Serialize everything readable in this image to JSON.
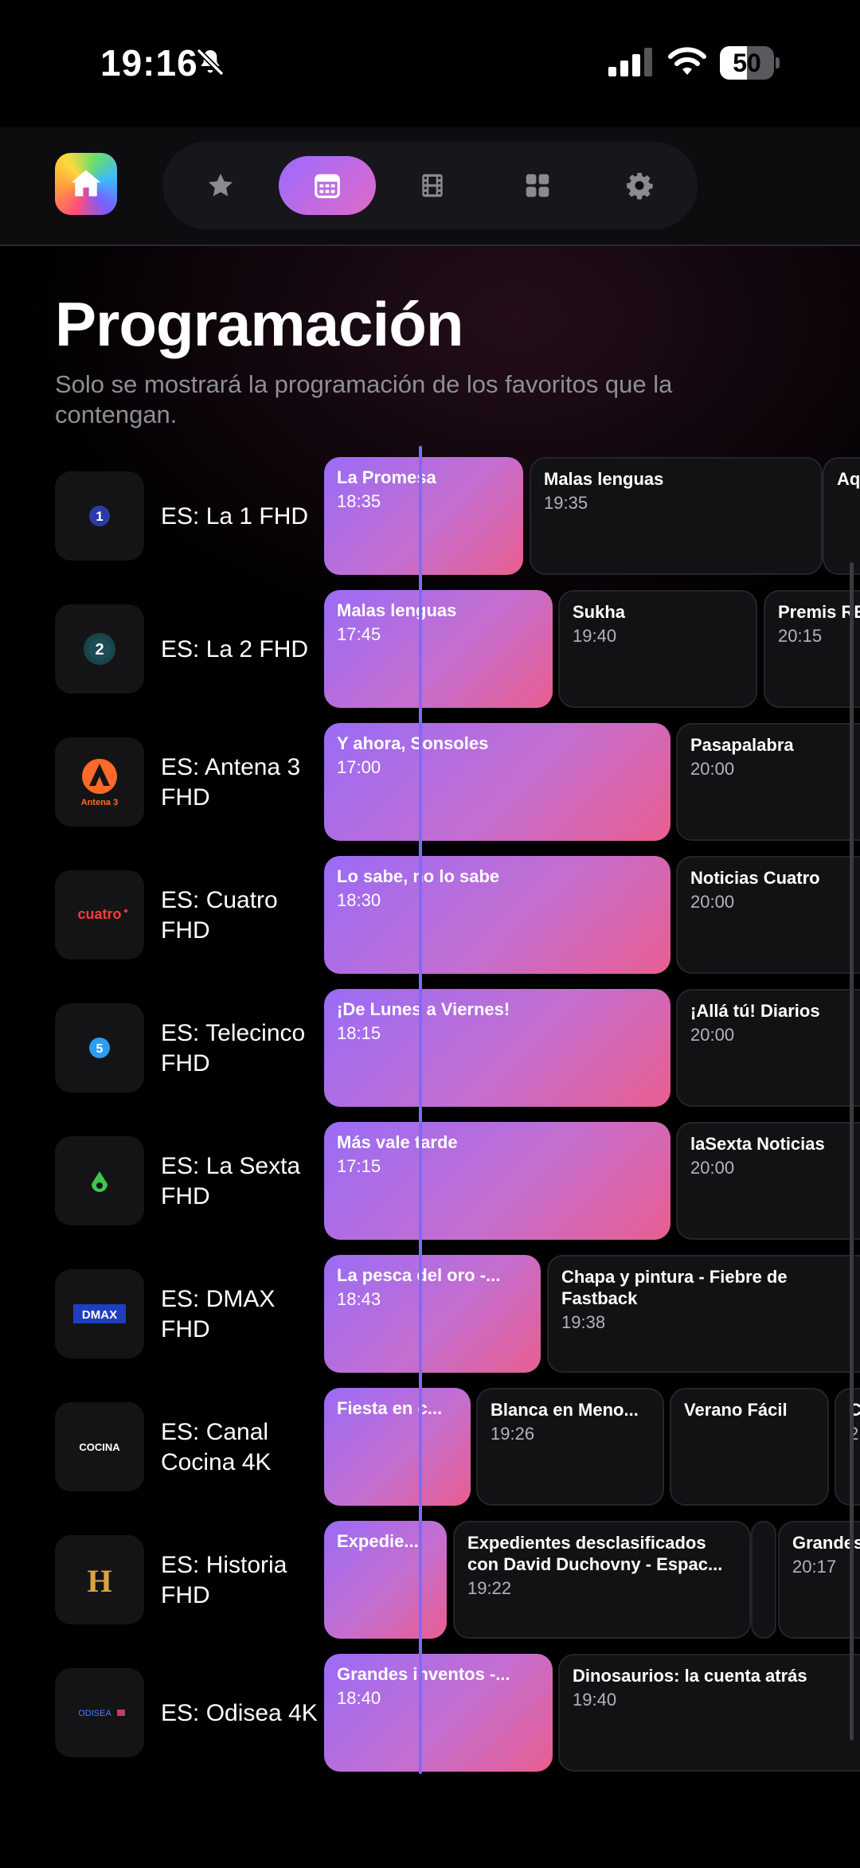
{
  "status_bar": {
    "time": "19:16",
    "battery": "50",
    "battery_level": 0.5
  },
  "nav": {
    "items": [
      "star-icon",
      "calendar-icon",
      "film-icon",
      "grid-icon",
      "gear-icon"
    ],
    "active": "calendar-icon"
  },
  "page": {
    "title": "Programación",
    "subtitle": "Solo se mostrará la programación de los favoritos que la contengan."
  },
  "colors": {
    "accent_start": "#9b6bff",
    "accent_end": "#e95e8f",
    "now_line": "#7b6bff"
  },
  "channels": [
    {
      "name": "ES: La 1 FHD",
      "programs": [
        {
          "title": "La Promesa",
          "time": "18:35"
        },
        {
          "title": "Malas lenguas",
          "time": "19:35"
        },
        {
          "title": "Aq",
          "time": ""
        }
      ]
    },
    {
      "name": "ES: La 2 FHD",
      "programs": [
        {
          "title": "Malas lenguas",
          "time": "17:45"
        },
        {
          "title": "Sukha",
          "time": "19:40"
        },
        {
          "title": "Premis RE",
          "time": "20:15"
        }
      ]
    },
    {
      "name": "ES: Antena 3 FHD",
      "logo_text": "Antena 3",
      "programs": [
        {
          "title": "Y ahora, Sonsoles",
          "time": "17:00"
        },
        {
          "title": "Pasapalabra",
          "time": "20:00"
        }
      ]
    },
    {
      "name": "ES: Cuatro FHD",
      "logo_text": "cuatro",
      "programs": [
        {
          "title": "Lo sabe, no lo sabe",
          "time": "18:30"
        },
        {
          "title": "Noticias Cuatro",
          "time": "20:00"
        }
      ]
    },
    {
      "name": "ES: Telecinco FHD",
      "programs": [
        {
          "title": "¡De Lunes a Viernes!",
          "time": "18:15"
        },
        {
          "title": "¡Allá tú! Diarios",
          "time": "20:00"
        }
      ]
    },
    {
      "name": "ES: La Sexta FHD",
      "programs": [
        {
          "title": "Más vale tarde",
          "time": "17:15"
        },
        {
          "title": "laSexta Noticias",
          "time": "20:00"
        }
      ]
    },
    {
      "name": "ES: DMAX FHD",
      "logo_text": "DMAX",
      "programs": [
        {
          "title": "La pesca del oro -...",
          "time": "18:43"
        },
        {
          "title": "Chapa y pintura - Fiebre de Fastback",
          "time": "19:38"
        }
      ]
    },
    {
      "name": "ES: Canal Cocina 4K",
      "logo_text": "COCINA",
      "programs": [
        {
          "title": "Fiesta en c...",
          "time": ""
        },
        {
          "title": "Blanca en Meno...",
          "time": "19:26"
        },
        {
          "title": "Verano Fácil",
          "time": ""
        },
        {
          "title": "C",
          "time": "2"
        }
      ]
    },
    {
      "name": "ES: Historia FHD",
      "logo_text": "H",
      "programs": [
        {
          "title": "Expedie...",
          "time": ""
        },
        {
          "title": "Expedientes desclasificados con David Duchovny - Espac...",
          "time": "19:22"
        },
        {
          "title": "",
          "time": ""
        },
        {
          "title": "Grandes",
          "time": "20:17"
        }
      ]
    },
    {
      "name": "ES: Odisea 4K",
      "logo_text": "ODISEA",
      "programs": [
        {
          "title": "Grandes inventos -...",
          "time": "18:40"
        },
        {
          "title": "Dinosaurios: la cuenta atrás",
          "time": "19:40"
        }
      ]
    }
  ]
}
